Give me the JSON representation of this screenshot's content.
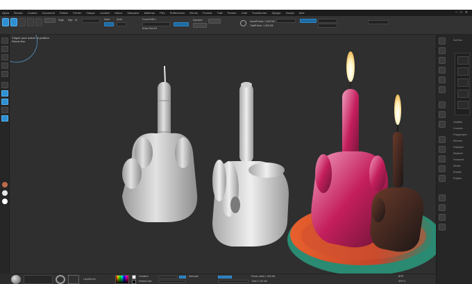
{
  "menu": {
    "items": [
      "Alpha",
      "Brosse",
      "Couleur",
      "Document",
      "Édition",
      "Fichier",
      "Calque",
      "Lumière",
      "Macro",
      "Marqueur",
      "Matériau",
      "Film",
      "Préférences",
      "Rendu",
      "Pochoir",
      "Trait",
      "Texture",
      "Outil",
      "Transformer",
      "Zplugin",
      "Zscript",
      "Aide"
    ],
    "window_controls": [
      "–",
      "□",
      "✕"
    ]
  },
  "toolbar": {
    "labels": [
      "Edit",
      "Draw",
      "Move",
      "Scale",
      "Rotate"
    ],
    "mrgb": "Mrgb",
    "rgb": "Rgb",
    "m": "M",
    "zadd": "Zadd",
    "zsub": "Zsub",
    "focal_shift": "Focal Shift 0",
    "draw_size": "Draw Size 64",
    "dynamic": "Dynamic",
    "active_points": "ActivePoints: 1.063 Mil",
    "total_points": "TotalPoints: 1.063 Mil"
  },
  "canvas": {
    "label_line1": "Cliquer pour activer la position",
    "label_line2": "Rendu flou"
  },
  "left_colors": [
    "#c06a4e",
    "#e8e8e8",
    "#ffffff"
  ],
  "right_panel": {
    "subtool_label": "SubTool",
    "items": [
      "Visibilité",
      "Couches",
      "Polygroupes",
      "Remesh",
      "Dupliquer",
      "Déplacer",
      "Fusionner",
      "Diviser",
      "Extraire",
      "Projeter"
    ]
  },
  "bottom": {
    "lazy_mouse": "LazyMouse",
    "alternate": "Alternate",
    "gradient": "Gradient",
    "switch_color": "SwitchColor",
    "poly_count": "Points actifs 1 063 Mil",
    "total": "Total 2 126 Mil",
    "bpr": "BPR",
    "spix": "SPix 3"
  },
  "colors": {
    "accent": "#2e8fd1",
    "background": "#2b2b2b",
    "canvas": "#2f2f2f",
    "candle_pink": "#c0245a",
    "candle_dark": "#3a2a2a",
    "plate_rim": "#2f8a7a",
    "plate_inner": "#d85a3a",
    "clay": "#cfcfcf"
  }
}
